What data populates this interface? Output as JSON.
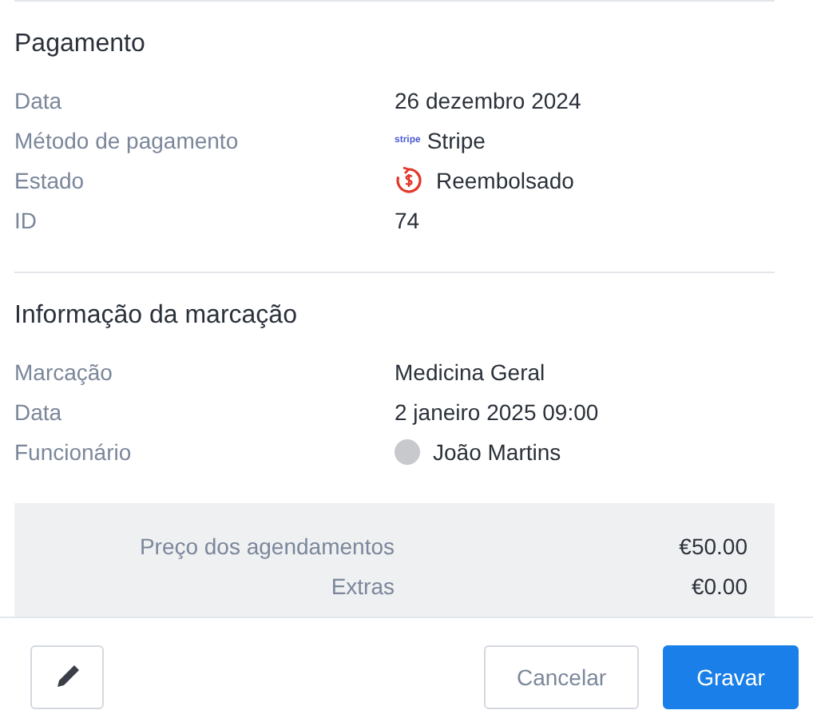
{
  "sections": [
    {
      "title": "Pagamento",
      "rows": [
        {
          "label": "Data",
          "value": "26 dezembro 2024",
          "kind": "text"
        },
        {
          "label": "Método de pagamento",
          "value": "Stripe",
          "kind": "logo",
          "logo_text": "stripe"
        },
        {
          "label": "Estado",
          "value": "Reembolsado",
          "kind": "status"
        },
        {
          "label": "ID",
          "value": "74",
          "kind": "text"
        }
      ]
    },
    {
      "title": "Informação da marcação",
      "rows": [
        {
          "label": "Marcação",
          "value": "Medicina Geral",
          "kind": "text"
        },
        {
          "label": "Data",
          "value": "2 janeiro 2025 09:00",
          "kind": "text"
        },
        {
          "label": "Funcionário",
          "value": "João Martins",
          "kind": "avatar"
        }
      ]
    }
  ],
  "totals": [
    {
      "label": "Preço dos agendamentos",
      "value": "€50.00"
    },
    {
      "label": "Extras",
      "value": "€0.00"
    }
  ],
  "buttons": {
    "cancel": "Cancelar",
    "save": "Gravar"
  }
}
